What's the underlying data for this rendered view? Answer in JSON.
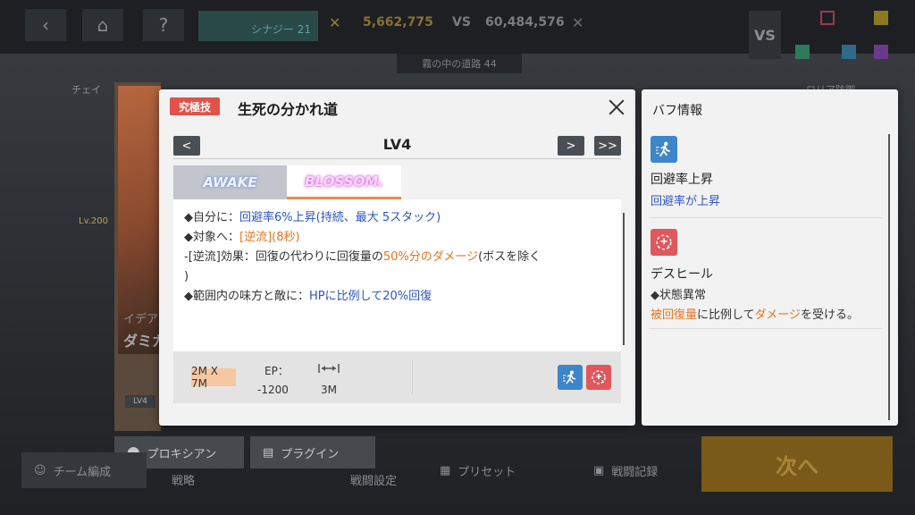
{
  "background": {
    "team_label": "シナジー 21",
    "team_small": "",
    "score_left": "5,662,775",
    "vs": "VS",
    "score_right": "60,484,576",
    "stage": "霧の中の道路 44",
    "logo": "VS",
    "left_tab": "チェイ",
    "left_level": "Lv.200",
    "left_text1": "イデア",
    "left_text2": "ダミカ",
    "left_lv": "LV4",
    "bottom": {
      "team_edit": "チーム編成",
      "tab1": "戦略",
      "tab2": "戦闘設定",
      "preset": "プリセット",
      "record": "戦闘記録",
      "next": "次へ",
      "proxy": "プロキシアン",
      "plugin": "プラグイン"
    },
    "right_label": "ロリア防御"
  },
  "dialog": {
    "badge": "究極技",
    "skill_name": "生死の分かれ道",
    "level": "LV4",
    "prev_symbol": "<",
    "next_symbol": ">",
    "last_symbol": ">>",
    "tabs": [
      {
        "label": "AWAKE"
      },
      {
        "label": "BLOSSOM."
      }
    ],
    "desc": {
      "l1_prefix": "◆自分に：",
      "l1_blue": "回避率6%上昇(持続、最大 5スタック)",
      "l2_prefix": "◆対象へ：",
      "l2_orange": "[逆流](8秒)",
      "l3_prefix": "-[逆流]効果：回復の代わりに回復量の",
      "l3_orange": "50%分のダメージ",
      "l3_suffix": "(ボスを除く",
      "l4": ")",
      "l5_prefix": "◆範囲内の味方と敵に：",
      "l5_blue": "HPに比例して20%回復"
    },
    "info": {
      "range": "2M X 7M",
      "ep_label": "EP：",
      "ep_value": "-1200",
      "distance": "3M"
    },
    "buff_icons": [
      "evasion-up-icon",
      "heal-reverse-icon"
    ]
  },
  "buff_panel": {
    "title": "バフ情報",
    "entries": [
      {
        "icon": "evasion-up-icon",
        "color": "#3e86c9",
        "name": "回避率上昇",
        "desc_blue1": "回避率",
        "desc_mid": "が",
        "desc_blue2": "上昇"
      },
      {
        "icon": "heal-reverse-icon",
        "color": "#e0575c",
        "name": "デスヒール",
        "tag": "◆状態異常",
        "desc_orange1": "被回復量",
        "desc_mid": "に比例して",
        "desc_orange2": "ダメージ",
        "desc_suffix": "を受ける。"
      }
    ]
  },
  "colors": {
    "badge_red": "#e15249",
    "text_blue": "#2b55c7",
    "text_orange": "#e8751e",
    "blossom_underline": "#f08a4a"
  }
}
